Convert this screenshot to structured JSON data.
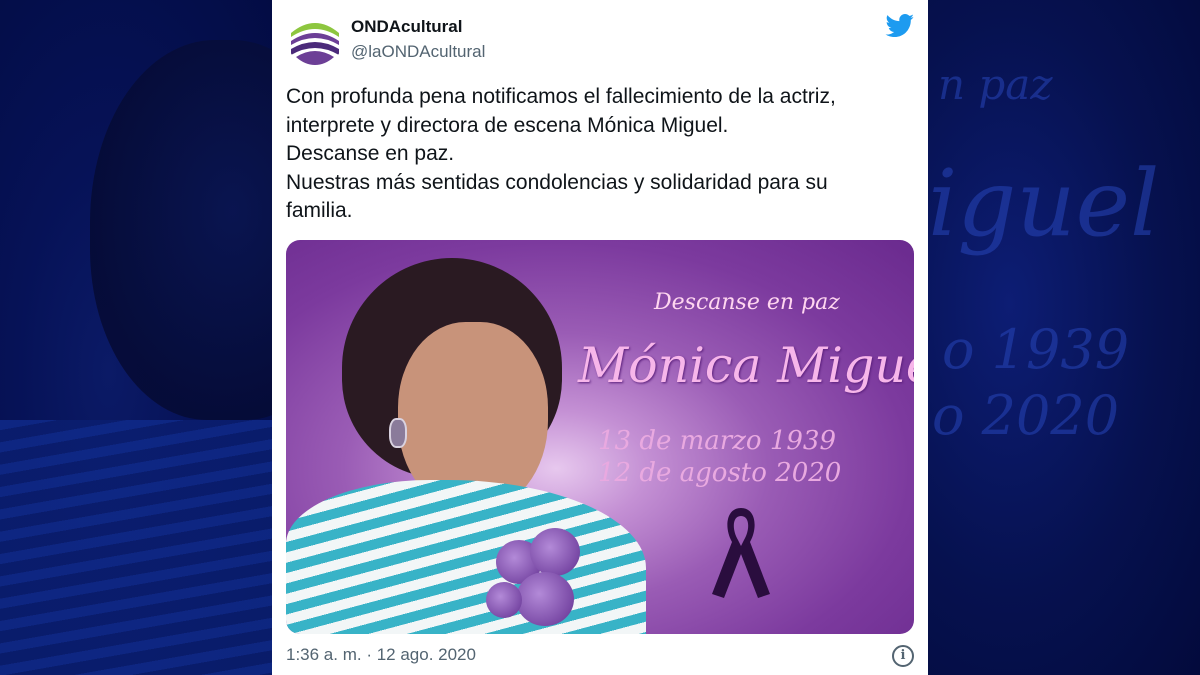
{
  "tweet": {
    "author_name": "ONDAcultural",
    "author_handle": "@laONDAcultural",
    "text_lines": [
      "Con profunda pena notificamos el fallecimiento de la actriz,",
      "interprete y directora de escena Mónica Miguel.",
      "Descanse en paz.",
      "Nuestras más sentidas condolencias y solidaridad para su",
      "familia."
    ],
    "timestamp": "1:36 a. m. · 12 ago. 2020",
    "info_glyph": "i"
  },
  "media": {
    "line1": "Descanse en paz",
    "name": "Mónica Miguel",
    "birth": "13 de marzo 1939",
    "death": "12 de agosto 2020"
  },
  "background": {
    "ghost_lines": [
      "n paz",
      "iguel",
      "o 1939",
      "o 2020"
    ]
  },
  "colors": {
    "twitter_blue": "#1d9bf0",
    "media_purple": "#7c3a9e",
    "background_navy": "#020a3a"
  },
  "icons": {
    "brand": "twitter-bird-icon",
    "info": "info-circle-icon",
    "ribbon": "mourning-ribbon-icon"
  }
}
